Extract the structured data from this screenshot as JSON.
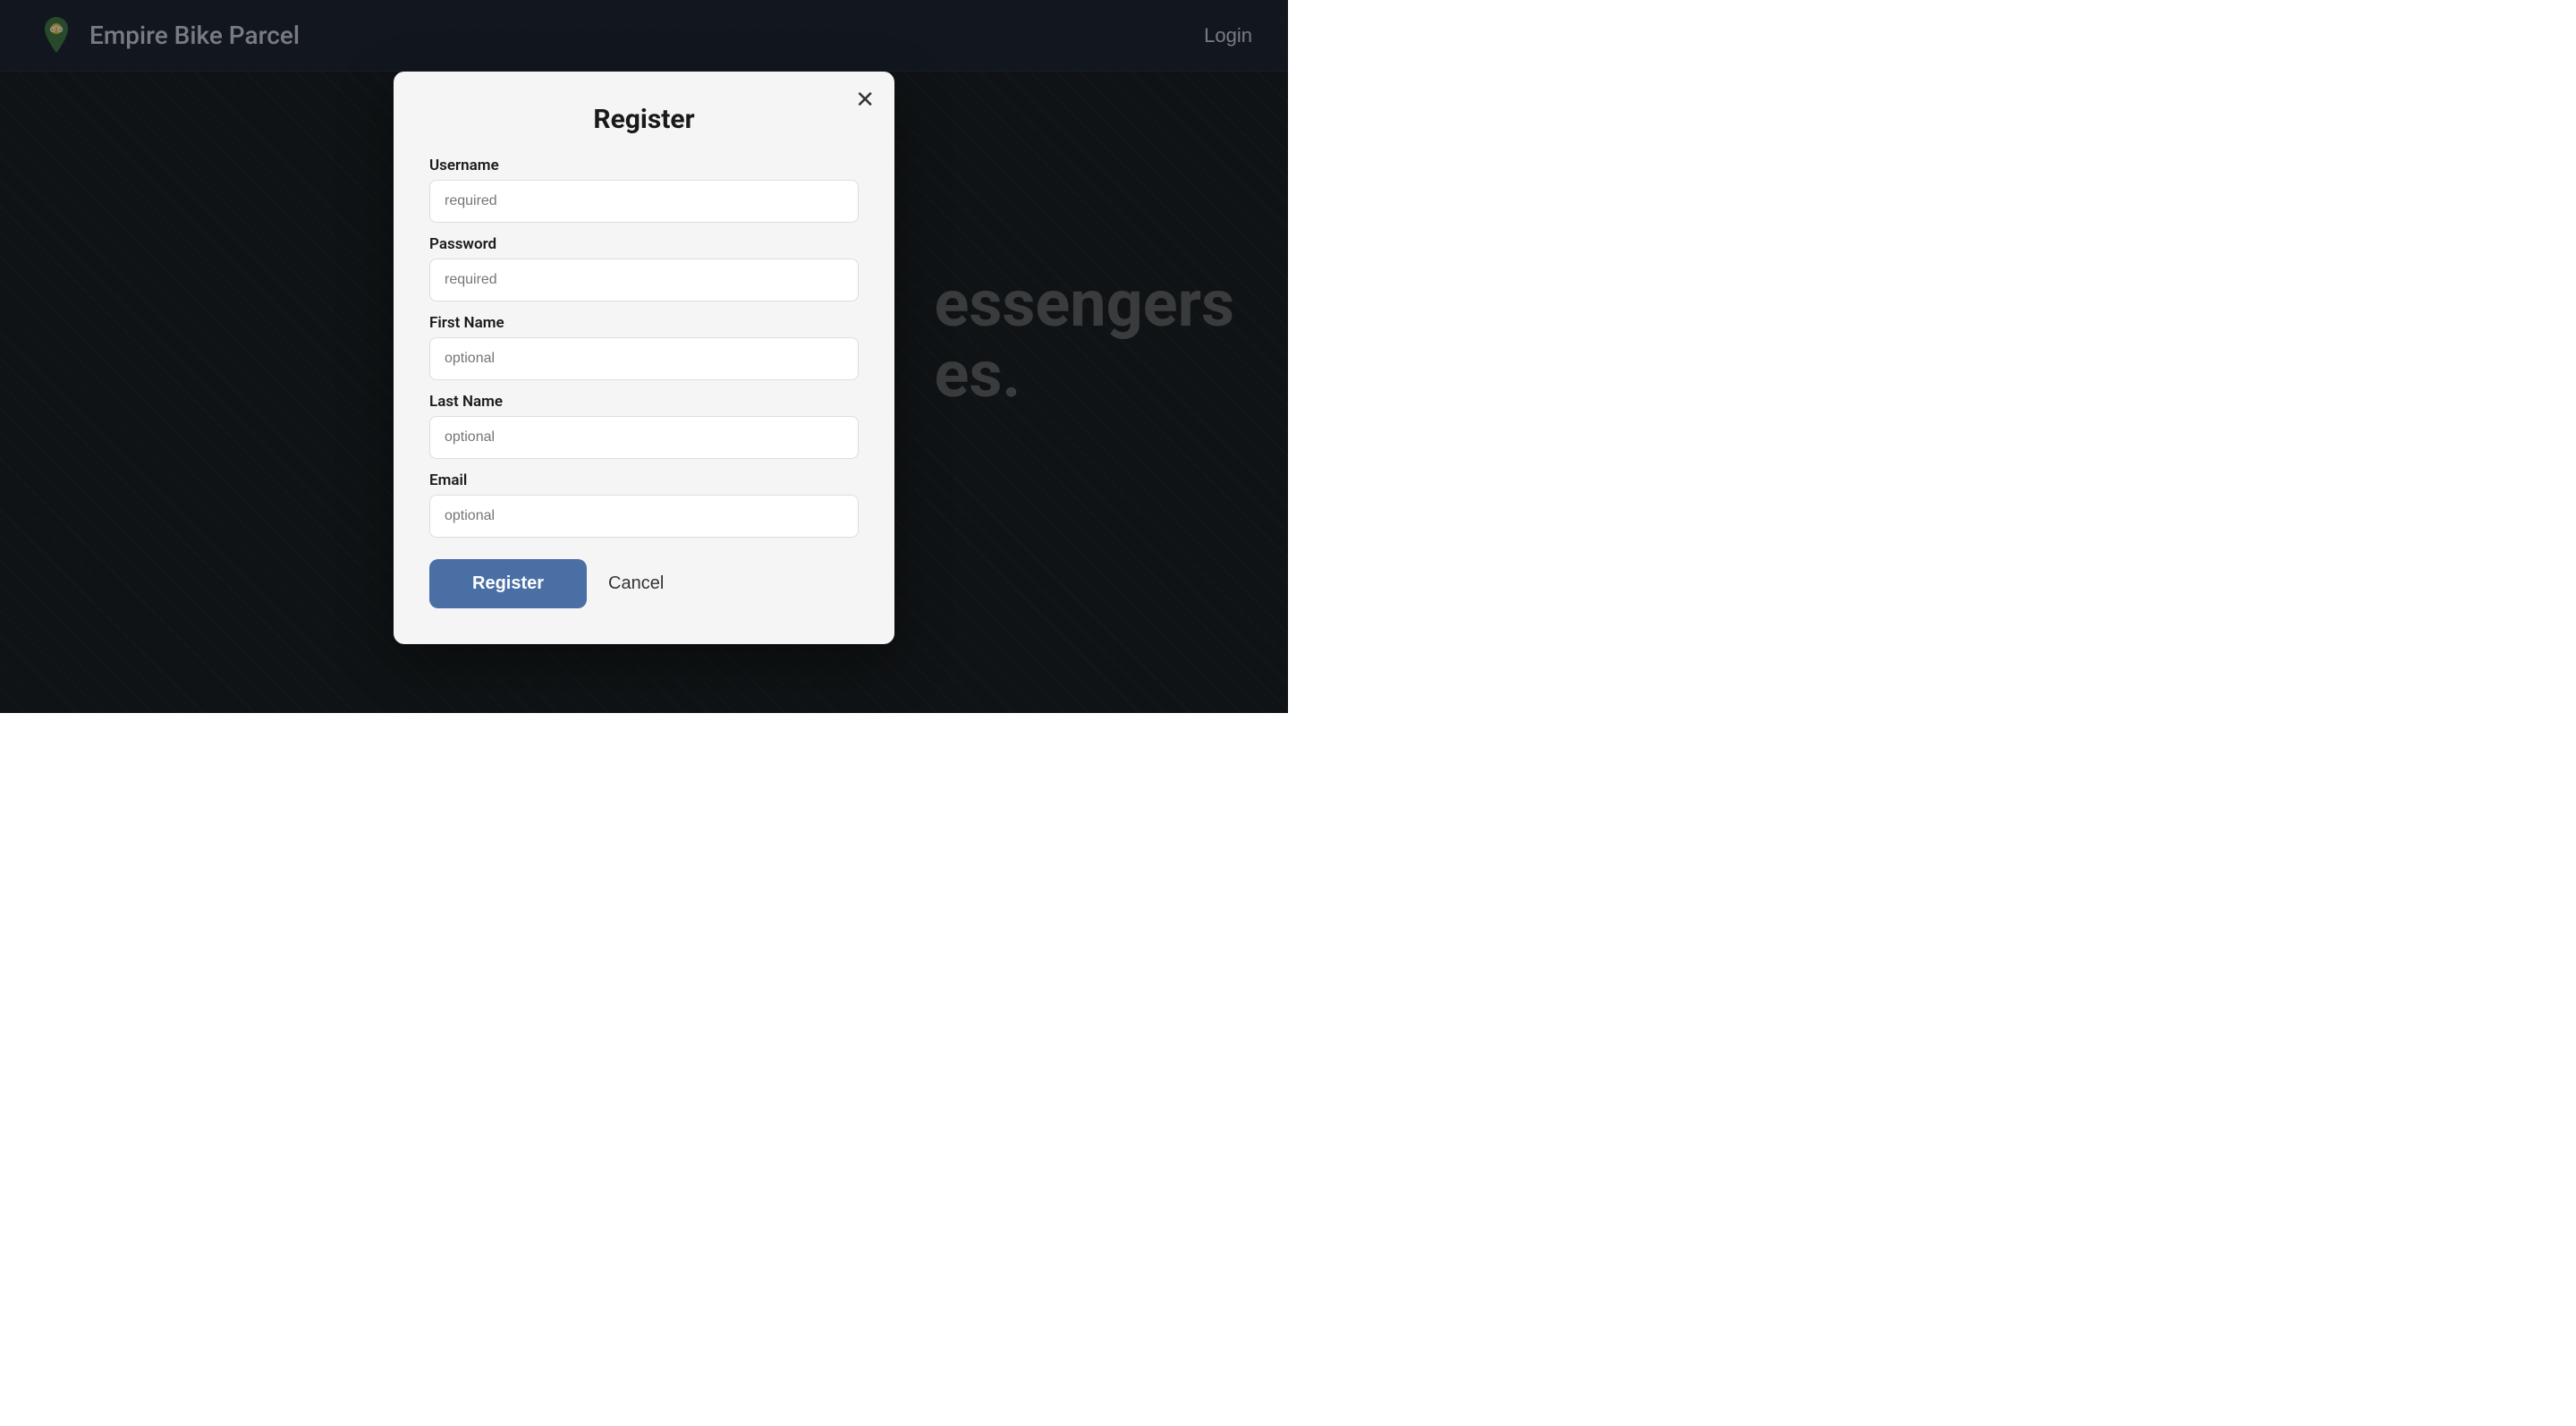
{
  "navbar": {
    "brand_name": "Empire Bike Parcel",
    "login_label": "Login"
  },
  "background": {
    "text_line1": "essengers",
    "text_line2": "es."
  },
  "modal": {
    "title": "Register",
    "close_label": "✕",
    "fields": [
      {
        "id": "username",
        "label": "Username",
        "placeholder": "required",
        "type": "text"
      },
      {
        "id": "password",
        "label": "Password",
        "placeholder": "required",
        "type": "password"
      },
      {
        "id": "first_name",
        "label": "First Name",
        "placeholder": "optional",
        "type": "text"
      },
      {
        "id": "last_name",
        "label": "Last Name",
        "placeholder": "optional",
        "type": "text"
      },
      {
        "id": "email",
        "label": "Email",
        "placeholder": "optional",
        "type": "email"
      }
    ],
    "register_button": "Register",
    "cancel_button": "Cancel"
  }
}
